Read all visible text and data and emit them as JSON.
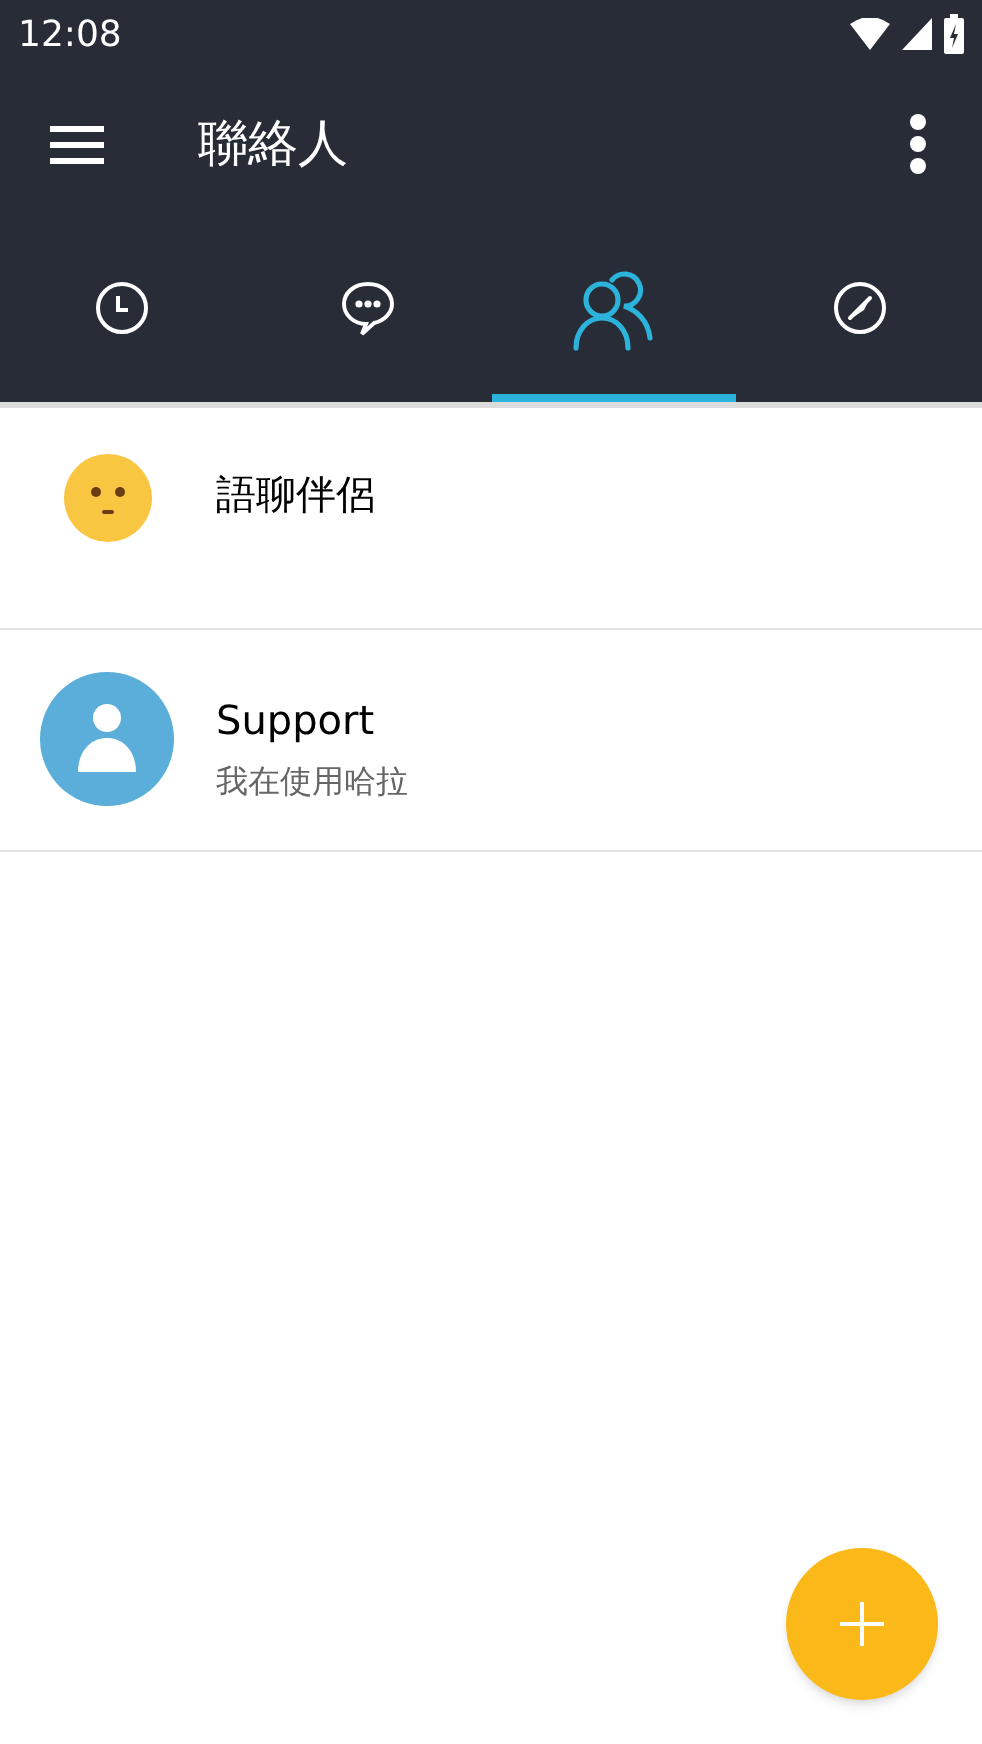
{
  "status_bar": {
    "time": "12:08"
  },
  "app_bar": {
    "title": "聯絡人"
  },
  "tabs": [
    {
      "kind": "clock",
      "selected": false
    },
    {
      "kind": "chat",
      "selected": false
    },
    {
      "kind": "contacts",
      "selected": true
    },
    {
      "kind": "compass",
      "selected": false
    }
  ],
  "contacts": [
    {
      "kind": "smiley",
      "name": "語聊伴侶"
    },
    {
      "kind": "person",
      "name": "Support",
      "status": "我在使用哈拉"
    }
  ],
  "fab": {
    "kind": "add"
  }
}
